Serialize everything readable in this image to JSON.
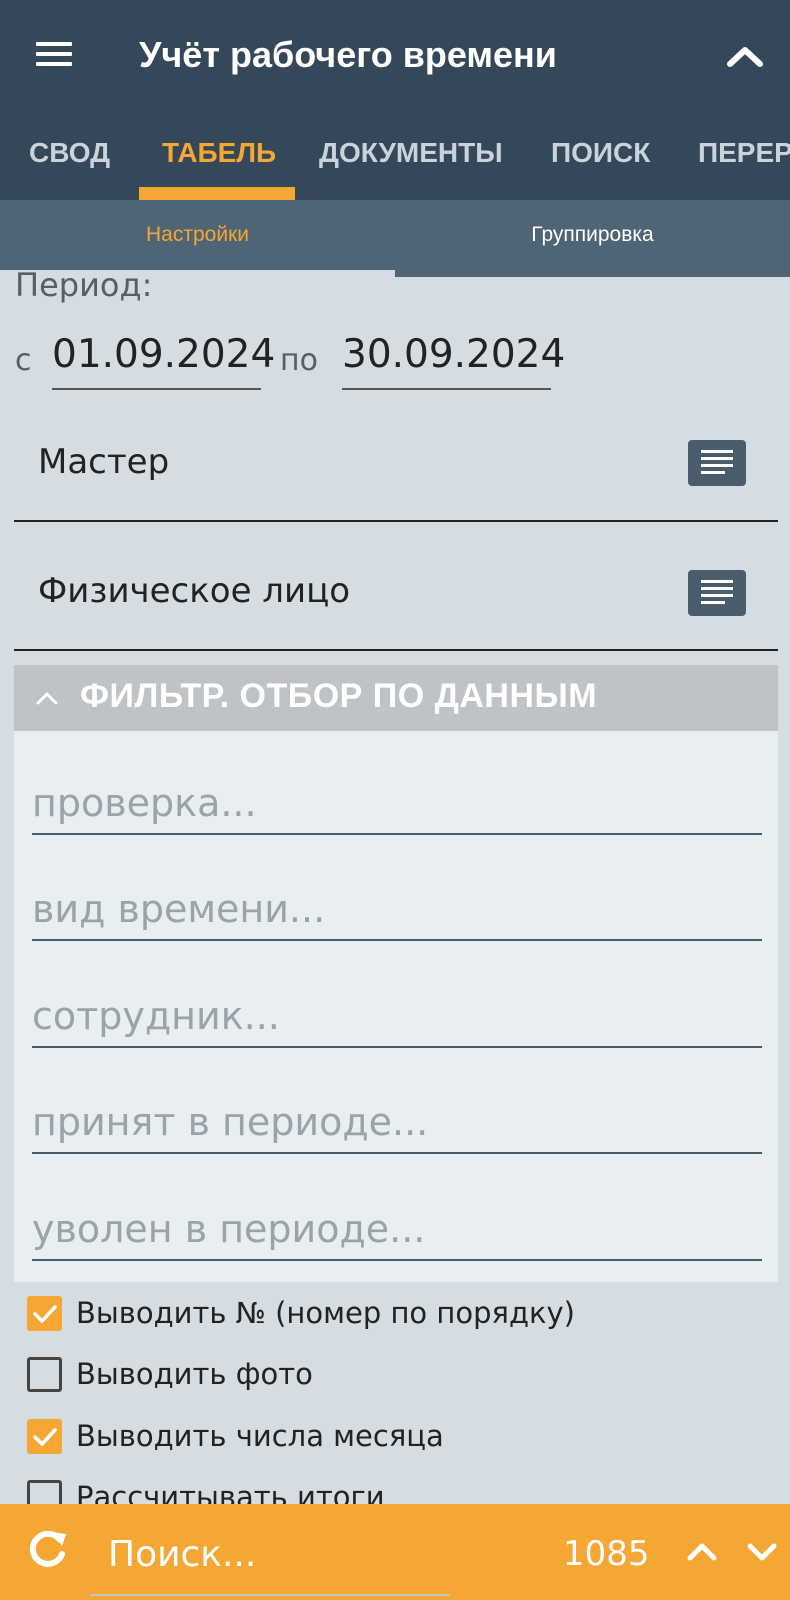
{
  "appbar": {
    "title": "Учёт рабочего времени",
    "icons": [
      "menu-icon",
      "chevron-up-icon"
    ]
  },
  "tabs": [
    {
      "label": "СВОД",
      "active": false
    },
    {
      "label": "ТАБЕЛЬ",
      "active": true
    },
    {
      "label": "ДОКУМЕНТЫ",
      "active": false
    },
    {
      "label": "ПОИСК",
      "active": false
    },
    {
      "label": "ПЕРЕРАСЧЁТ",
      "active": false
    }
  ],
  "subtabs": [
    {
      "label": "Настройки",
      "active": true
    },
    {
      "label": "Группировка",
      "active": false
    }
  ],
  "period": {
    "label": "Период:",
    "from_label": "с",
    "from_value": "01.09.2024",
    "to_label": "по",
    "to_value": "30.09.2024"
  },
  "selectors": [
    {
      "label": "Мастер",
      "icon": "list-icon"
    },
    {
      "label": "Физическое лицо",
      "icon": "list-icon"
    }
  ],
  "filter": {
    "title": "ФИЛЬТР. ОТБОР ПО ДАННЫМ",
    "expanded": true,
    "fields": [
      {
        "placeholder": "проверка..."
      },
      {
        "placeholder": "вид времени..."
      },
      {
        "placeholder": "сотрудник..."
      },
      {
        "placeholder": "принят в периоде..."
      },
      {
        "placeholder": "уволен в периоде..."
      }
    ]
  },
  "options": [
    {
      "label": "Выводить № (номер по порядку)",
      "checked": true
    },
    {
      "label": "Выводить фото",
      "checked": false
    },
    {
      "label": "Выводить числа месяца",
      "checked": true
    },
    {
      "label": "Рассчитывать итоги",
      "checked": false
    }
  ],
  "bottombar": {
    "search_placeholder": "Поиск...",
    "count": "1085",
    "icons": [
      "refresh-icon",
      "chevron-up-icon",
      "chevron-down-icon"
    ]
  },
  "colors": {
    "appbar": "#34485a",
    "accent": "#f4a733",
    "subtabs": "#4f6474",
    "background": "#d5dde2",
    "filter_header": "#bfc3c6"
  }
}
